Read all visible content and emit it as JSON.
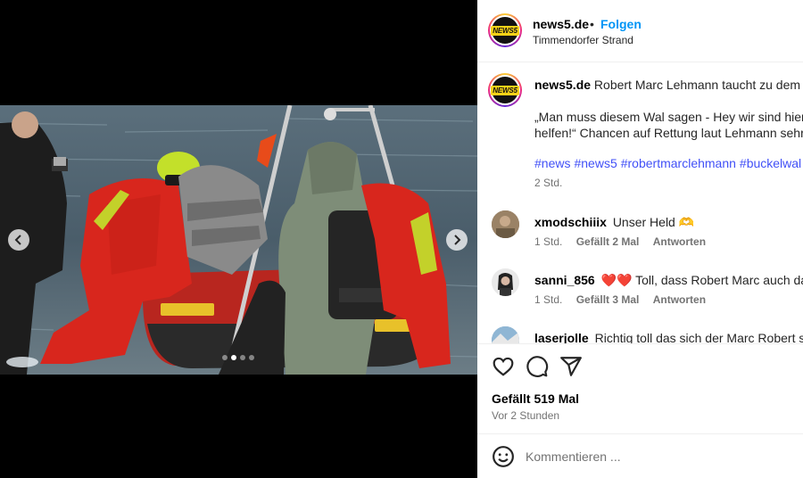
{
  "post": {
    "username": "news5.de",
    "separator": "•",
    "follow_label": "Folgen",
    "location": "Timmendorfer Strand",
    "logo_text": "NEWS5"
  },
  "caption": {
    "username": "news5.de",
    "text": "Robert Marc Lehmann taucht zu dem Ti",
    "quote_line1": "„Man muss diesem Wal sagen - Hey wir sind hier u",
    "quote_line2": "helfen!“ Chancen auf Rettung laut Lehmann sehr g",
    "hashtags": [
      "#news",
      "#news5",
      "#robertmarclehmann",
      "#buckelwal",
      "#"
    ],
    "time": "2 Std."
  },
  "comments": [
    {
      "username": "xmodschiiix",
      "text": "Unser Held 🫶",
      "time": "1 Std.",
      "likes": "Gefällt 2 Mal",
      "reply": "Antworten"
    },
    {
      "username": "sanni_856",
      "text": "❤️❤️ Toll, dass Robert Marc auch da is",
      "time": "1 Std.",
      "likes": "Gefällt 3 Mal",
      "reply": "Antworten"
    },
    {
      "username": "laserjolle",
      "text": "Richtig toll das sich der Marc Robert so t"
    }
  ],
  "actions": {
    "like_icon": "heart-icon",
    "comment_icon": "comment-bubble-icon",
    "share_icon": "paper-plane-icon",
    "likes_count": "Gefällt 519 Mal",
    "posted": "Vor 2 Stunden"
  },
  "comment_input": {
    "placeholder": "Kommentieren ..."
  },
  "carousel": {
    "slides": 4,
    "active_slide": 2
  },
  "colors": {
    "link_blue": "#0095f6",
    "hashtag_blue": "#4150f7",
    "muted": "#737373",
    "suit_red": "#d8261d"
  }
}
